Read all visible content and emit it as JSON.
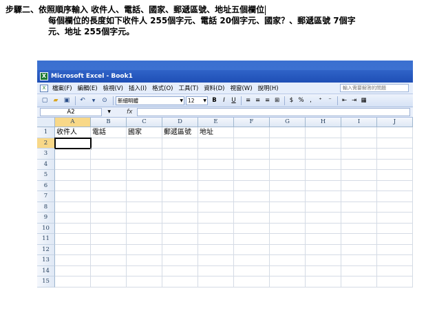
{
  "instructions": {
    "line1": "步驟二、依照順序輸入 收件人、電話、國家、郵遞區號、地址五個欄位",
    "line2": "每個欄位的長度如下收件人 255個字元、電話 20個字元、國家？、郵遞區號 7個字",
    "line3": "元、地址 255個字元。"
  },
  "window": {
    "title": "Microsoft Excel - Book1"
  },
  "menu": {
    "items": [
      "檔案(F)",
      "編輯(E)",
      "檢視(V)",
      "插入(I)",
      "格式(O)",
      "工具(T)",
      "資料(D)",
      "視窗(W)",
      "說明(H)"
    ],
    "help_placeholder": "輸入需要解答的問題"
  },
  "toolbar": {
    "font": "新細明體",
    "size": "12",
    "bold": "B",
    "italic": "I",
    "underline": "U",
    "currency": "$",
    "percent": "%"
  },
  "formula_bar": {
    "name_box": "A2",
    "fx": "fx",
    "value": ""
  },
  "sheet": {
    "columns": [
      "A",
      "B",
      "C",
      "D",
      "E",
      "F",
      "G",
      "H",
      "I",
      "J"
    ],
    "active_column": "A",
    "active_row": 2,
    "rows": [
      {
        "num": "1",
        "cells": [
          "收件人",
          "電話",
          "國家",
          "郵遞區號",
          "地址",
          "",
          "",
          "",
          "",
          ""
        ]
      },
      {
        "num": "2",
        "cells": [
          "",
          "",
          "",
          "",
          "",
          "",
          "",
          "",
          "",
          ""
        ]
      },
      {
        "num": "3",
        "cells": [
          "",
          "",
          "",
          "",
          "",
          "",
          "",
          "",
          "",
          ""
        ]
      },
      {
        "num": "4",
        "cells": [
          "",
          "",
          "",
          "",
          "",
          "",
          "",
          "",
          "",
          ""
        ]
      },
      {
        "num": "5",
        "cells": [
          "",
          "",
          "",
          "",
          "",
          "",
          "",
          "",
          "",
          ""
        ]
      },
      {
        "num": "6",
        "cells": [
          "",
          "",
          "",
          "",
          "",
          "",
          "",
          "",
          "",
          ""
        ]
      },
      {
        "num": "7",
        "cells": [
          "",
          "",
          "",
          "",
          "",
          "",
          "",
          "",
          "",
          ""
        ]
      },
      {
        "num": "8",
        "cells": [
          "",
          "",
          "",
          "",
          "",
          "",
          "",
          "",
          "",
          ""
        ]
      },
      {
        "num": "9",
        "cells": [
          "",
          "",
          "",
          "",
          "",
          "",
          "",
          "",
          "",
          ""
        ]
      },
      {
        "num": "10",
        "cells": [
          "",
          "",
          "",
          "",
          "",
          "",
          "",
          "",
          "",
          ""
        ]
      },
      {
        "num": "11",
        "cells": [
          "",
          "",
          "",
          "",
          "",
          "",
          "",
          "",
          "",
          ""
        ]
      },
      {
        "num": "12",
        "cells": [
          "",
          "",
          "",
          "",
          "",
          "",
          "",
          "",
          "",
          ""
        ]
      },
      {
        "num": "13",
        "cells": [
          "",
          "",
          "",
          "",
          "",
          "",
          "",
          "",
          "",
          ""
        ]
      },
      {
        "num": "14",
        "cells": [
          "",
          "",
          "",
          "",
          "",
          "",
          "",
          "",
          "",
          ""
        ]
      },
      {
        "num": "15",
        "cells": [
          "",
          "",
          "",
          "",
          "",
          "",
          "",
          "",
          "",
          ""
        ]
      }
    ]
  },
  "colors": {
    "title_bar": "#1f4fb5",
    "header_active": "#f8d888",
    "excel_green": "#1d7a33"
  }
}
